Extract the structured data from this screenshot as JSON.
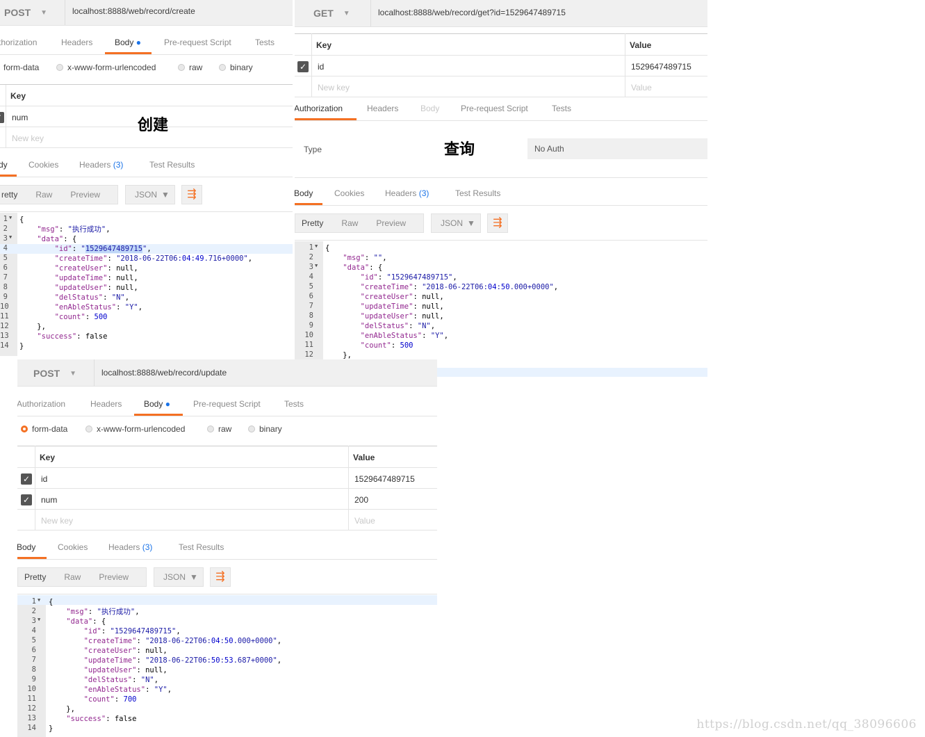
{
  "create": {
    "method": "POST",
    "url": "localhost:8888/web/record/create",
    "req_tabs": [
      "thorization",
      "Headers",
      "Body",
      "Pre-request Script",
      "Tests"
    ],
    "body_types": [
      "form-data",
      "x-www-form-urlencoded",
      "raw",
      "binary"
    ],
    "table_header": {
      "key": "Key"
    },
    "rows": [
      {
        "key": "num"
      }
    ],
    "new_key_placeholder": "New key",
    "big_label": "创建",
    "resp_tabs": [
      "dy",
      "Cookies",
      "Headers",
      "(3)",
      "Test Results"
    ],
    "view_modes": [
      "retty",
      "Raw",
      "Preview"
    ],
    "format": "JSON",
    "json_lines": [
      {
        "n": "1",
        "t": "{"
      },
      {
        "n": "2",
        "t": "    \"msg\": \"执行成功\","
      },
      {
        "n": "3",
        "t": "    \"data\": {"
      },
      {
        "n": "4",
        "t": "        \"id\": \"1529647489715\","
      },
      {
        "n": "5",
        "t": "        \"createTime\": \"2018-06-22T06:04:49.716+0000\","
      },
      {
        "n": "6",
        "t": "        \"createUser\": null,"
      },
      {
        "n": "7",
        "t": "        \"updateTime\": null,"
      },
      {
        "n": "8",
        "t": "        \"updateUser\": null,"
      },
      {
        "n": "9",
        "t": "        \"delStatus\": \"N\","
      },
      {
        "n": "10",
        "t": "        \"enAbleStatus\": \"Y\","
      },
      {
        "n": "11",
        "t": "        \"count\": 500"
      },
      {
        "n": "12",
        "t": "    },"
      },
      {
        "n": "13",
        "t": "    \"success\": false"
      },
      {
        "n": "14",
        "t": "}"
      }
    ]
  },
  "query": {
    "method": "GET",
    "url": "localhost:8888/web/record/get?id=1529647489715",
    "table_header": {
      "key": "Key",
      "value": "Value"
    },
    "rows": [
      {
        "key": "id",
        "value": "1529647489715"
      }
    ],
    "new_key_placeholder": "New key",
    "value_placeholder": "Value",
    "req_tabs": [
      "Authorization",
      "Headers",
      "Body",
      "Pre-request Script",
      "Tests"
    ],
    "auth_type_label": "Type",
    "auth_type_value": "No Auth",
    "big_label": "查询",
    "resp_tabs": [
      "Body",
      "Cookies",
      "Headers",
      "(3)",
      "Test Results"
    ],
    "view_modes": [
      "Pretty",
      "Raw",
      "Preview"
    ],
    "format": "JSON",
    "json_lines": [
      {
        "n": "1",
        "t": "{"
      },
      {
        "n": "2",
        "t": "    \"msg\": \"\","
      },
      {
        "n": "3",
        "t": "    \"data\": {"
      },
      {
        "n": "4",
        "t": "        \"id\": \"1529647489715\","
      },
      {
        "n": "5",
        "t": "        \"createTime\": \"2018-06-22T06:04:50.000+0000\","
      },
      {
        "n": "6",
        "t": "        \"createUser\": null,"
      },
      {
        "n": "7",
        "t": "        \"updateTime\": null,"
      },
      {
        "n": "8",
        "t": "        \"updateUser\": null,"
      },
      {
        "n": "9",
        "t": "        \"delStatus\": \"N\","
      },
      {
        "n": "10",
        "t": "        \"enAbleStatus\": \"Y\","
      },
      {
        "n": "11",
        "t": "        \"count\": 500"
      },
      {
        "n": "12",
        "t": "    },"
      }
    ]
  },
  "update": {
    "method": "POST",
    "url": "localhost:8888/web/record/update",
    "req_tabs": [
      "Authorization",
      "Headers",
      "Body",
      "Pre-request Script",
      "Tests"
    ],
    "body_types": [
      "form-data",
      "x-www-form-urlencoded",
      "raw",
      "binary"
    ],
    "table_header": {
      "key": "Key",
      "value": "Value"
    },
    "rows": [
      {
        "key": "id",
        "value": "1529647489715"
      },
      {
        "key": "num",
        "value": "200"
      }
    ],
    "new_key_placeholder": "New key",
    "value_placeholder": "Value",
    "resp_tabs": [
      "Body",
      "Cookies",
      "Headers",
      "(3)",
      "Test Results"
    ],
    "view_modes": [
      "Pretty",
      "Raw",
      "Preview"
    ],
    "format": "JSON",
    "json_lines": [
      {
        "n": "1",
        "t": "{"
      },
      {
        "n": "2",
        "t": "    \"msg\": \"执行成功\","
      },
      {
        "n": "3",
        "t": "    \"data\": {"
      },
      {
        "n": "4",
        "t": "        \"id\": \"1529647489715\","
      },
      {
        "n": "5",
        "t": "        \"createTime\": \"2018-06-22T06:04:50.000+0000\","
      },
      {
        "n": "6",
        "t": "        \"createUser\": null,"
      },
      {
        "n": "7",
        "t": "        \"updateTime\": \"2018-06-22T06:50:53.687+0000\","
      },
      {
        "n": "8",
        "t": "        \"updateUser\": null,"
      },
      {
        "n": "9",
        "t": "        \"delStatus\": \"N\","
      },
      {
        "n": "10",
        "t": "        \"enAbleStatus\": \"Y\","
      },
      {
        "n": "11",
        "t": "        \"count\": 700"
      },
      {
        "n": "12",
        "t": "    },"
      },
      {
        "n": "13",
        "t": "    \"success\": false"
      },
      {
        "n": "14",
        "t": "}"
      }
    ]
  },
  "watermark": "https://blog.csdn.net/qq_38096606",
  "colors": {
    "accent": "#f47023",
    "dot": "#1a73e8",
    "selection": "#bfd6f7"
  }
}
